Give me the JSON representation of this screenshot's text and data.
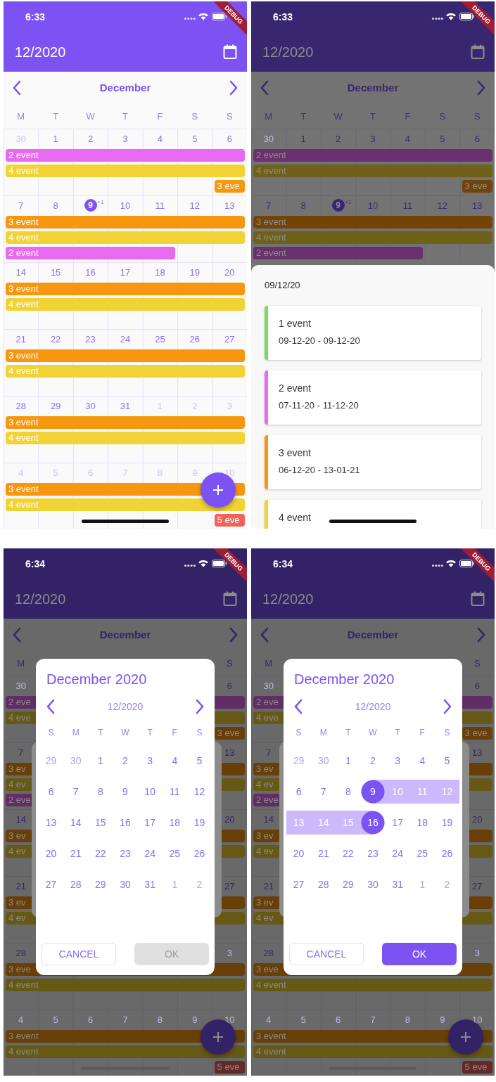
{
  "screens": [
    {
      "kind": "month",
      "status_time": "6:33",
      "banner": "DEBUG",
      "title": "12/2020",
      "month": "December",
      "weekdays": [
        {
          "label": "M"
        },
        {
          "label": "T"
        },
        {
          "label": "W"
        },
        {
          "label": "T"
        },
        {
          "label": "F"
        },
        {
          "label": "S"
        },
        {
          "label": "S"
        }
      ],
      "weeks": [
        {
          "days": [
            {
              "label": "30",
              "muted": true,
              "today": false
            },
            {
              "label": "1",
              "muted": false,
              "today": false
            },
            {
              "label": "2",
              "muted": false,
              "today": false
            },
            {
              "label": "3",
              "muted": false,
              "today": false
            },
            {
              "label": "4",
              "muted": false,
              "today": false
            },
            {
              "label": "5",
              "muted": false,
              "today": false
            },
            {
              "label": "6",
              "muted": false,
              "today": false
            }
          ],
          "events": [
            {
              "label": "2 event",
              "color": "#e86af0",
              "kind": "full"
            },
            {
              "label": "4 event",
              "color": "#f2d335",
              "kind": "full"
            },
            {
              "label": "3 eve",
              "color": "#f7970f",
              "kind": "sunday"
            }
          ]
        },
        {
          "days": [
            {
              "label": "7",
              "muted": false,
              "today": false
            },
            {
              "label": "8",
              "muted": false,
              "today": false
            },
            {
              "label": "9",
              "muted": false,
              "today": true,
              "extra": "+1"
            },
            {
              "label": "10",
              "muted": false,
              "today": false
            },
            {
              "label": "11",
              "muted": false,
              "today": false
            },
            {
              "label": "12",
              "muted": false,
              "today": false
            },
            {
              "label": "13",
              "muted": false,
              "today": false
            }
          ],
          "events": [
            {
              "label": "3 event",
              "color": "#f7970f",
              "kind": "full"
            },
            {
              "label": "4 event",
              "color": "#f2d335",
              "kind": "full"
            },
            {
              "label": "2 event",
              "color": "#e86af0",
              "kind": "weekdays"
            }
          ]
        },
        {
          "days": [
            {
              "label": "14",
              "muted": false,
              "today": false
            },
            {
              "label": "15",
              "muted": false,
              "today": false
            },
            {
              "label": "16",
              "muted": false,
              "today": false
            },
            {
              "label": "17",
              "muted": false,
              "today": false
            },
            {
              "label": "18",
              "muted": false,
              "today": false
            },
            {
              "label": "19",
              "muted": false,
              "today": false
            },
            {
              "label": "20",
              "muted": false,
              "today": false
            }
          ],
          "events": [
            {
              "label": "3 event",
              "color": "#f7970f",
              "kind": "full"
            },
            {
              "label": "4 event",
              "color": "#f2d335",
              "kind": "full"
            }
          ]
        },
        {
          "days": [
            {
              "label": "21",
              "muted": false,
              "today": false
            },
            {
              "label": "22",
              "muted": false,
              "today": false
            },
            {
              "label": "23",
              "muted": false,
              "today": false
            },
            {
              "label": "24",
              "muted": false,
              "today": false
            },
            {
              "label": "25",
              "muted": false,
              "today": false
            },
            {
              "label": "26",
              "muted": false,
              "today": false
            },
            {
              "label": "27",
              "muted": false,
              "today": false
            }
          ],
          "events": [
            {
              "label": "3 event",
              "color": "#f7970f",
              "kind": "full"
            },
            {
              "label": "4 event",
              "color": "#f2d335",
              "kind": "full"
            }
          ]
        },
        {
          "days": [
            {
              "label": "28",
              "muted": false,
              "today": false
            },
            {
              "label": "29",
              "muted": false,
              "today": false
            },
            {
              "label": "30",
              "muted": false,
              "today": false
            },
            {
              "label": "31",
              "muted": false,
              "today": false
            },
            {
              "label": "1",
              "muted": true,
              "today": false
            },
            {
              "label": "2",
              "muted": true,
              "today": false
            },
            {
              "label": "3",
              "muted": true,
              "today": false
            }
          ],
          "events": [
            {
              "label": "3 event",
              "color": "#f7970f",
              "kind": "full"
            },
            {
              "label": "4 event",
              "color": "#f2d335",
              "kind": "full"
            }
          ]
        },
        {
          "days": [
            {
              "label": "4",
              "muted": true,
              "today": false
            },
            {
              "label": "5",
              "muted": true,
              "today": false
            },
            {
              "label": "6",
              "muted": true,
              "today": false
            },
            {
              "label": "7",
              "muted": true,
              "today": false
            },
            {
              "label": "8",
              "muted": true,
              "today": false
            },
            {
              "label": "9",
              "muted": true,
              "today": false
            },
            {
              "label": "10",
              "muted": true,
              "today": false
            }
          ],
          "events": [
            {
              "label": "3 event",
              "color": "#f7970f",
              "kind": "full"
            },
            {
              "label": "4 event",
              "color": "#f2d335",
              "kind": "full"
            },
            {
              "label": "5 eve",
              "color": "#f1625a",
              "kind": "sunday"
            }
          ]
        }
      ]
    },
    {
      "kind": "day-sheet",
      "status_time": "6:33",
      "banner": "DEBUG",
      "title": "12/2020",
      "month": "December",
      "weekdays": [
        {
          "label": "M"
        },
        {
          "label": "T"
        },
        {
          "label": "W"
        },
        {
          "label": "T"
        },
        {
          "label": "F"
        },
        {
          "label": "S"
        },
        {
          "label": "S"
        }
      ],
      "weeks": [
        {
          "days": [
            {
              "label": "30",
              "muted": true,
              "today": false
            },
            {
              "label": "1",
              "muted": false,
              "today": false
            },
            {
              "label": "2",
              "muted": false,
              "today": false
            },
            {
              "label": "3",
              "muted": false,
              "today": false
            },
            {
              "label": "4",
              "muted": false,
              "today": false
            },
            {
              "label": "5",
              "muted": false,
              "today": false
            },
            {
              "label": "6",
              "muted": false,
              "today": false
            }
          ],
          "events": [
            {
              "label": "2 event",
              "color": "#6b316e",
              "kind": "full"
            },
            {
              "label": "4 event",
              "color": "#6f6118",
              "kind": "full"
            },
            {
              "label": "3 eve",
              "color": "#724507",
              "kind": "sunday"
            }
          ]
        },
        {
          "days": [
            {
              "label": "7",
              "muted": false,
              "today": false
            },
            {
              "label": "8",
              "muted": false,
              "today": false
            },
            {
              "label": "9",
              "muted": false,
              "today": true,
              "extra": "+1"
            },
            {
              "label": "10",
              "muted": false,
              "today": false
            },
            {
              "label": "11",
              "muted": false,
              "today": false
            },
            {
              "label": "12",
              "muted": false,
              "today": false
            },
            {
              "label": "13",
              "muted": false,
              "today": false
            }
          ],
          "events": [
            {
              "label": "3 event",
              "color": "#724507",
              "kind": "full"
            },
            {
              "label": "4 event",
              "color": "#6f6118",
              "kind": "full"
            },
            {
              "label": "2 event",
              "color": "#6b316e",
              "kind": "weekdays"
            }
          ]
        }
      ],
      "sheet": {
        "date": "09/12/20",
        "events": [
          {
            "title": "1 event",
            "range": "09-12-20 - 09-12-20",
            "color": "#7ed860"
          },
          {
            "title": "2 event",
            "range": "07-11-20 - 11-12-20",
            "color": "#e86af0"
          },
          {
            "title": "3 event",
            "range": "06-12-20 - 13-01-21",
            "color": "#f7970f"
          },
          {
            "title": "4 event",
            "color": "#f2d335"
          }
        ]
      }
    },
    {
      "kind": "range-dialog",
      "status_time": "6:34",
      "banner": "DEBUG",
      "title": "12/2020",
      "month": "December",
      "weekdays": [
        {
          "label": "M",
          "kind": "first"
        },
        {
          "label": "S",
          "kind": "last"
        }
      ],
      "weeks": [
        {
          "days": [
            {
              "label": "30",
              "kind": "first",
              "muted": true,
              "today": false
            },
            {
              "label": "6",
              "kind": "last",
              "muted": false,
              "today": false
            }
          ],
          "events": [
            {
              "label": "2 eve",
              "color": "#612d65",
              "kind": "full"
            },
            {
              "label": "4 eve",
              "color": "#665916",
              "kind": "full"
            },
            {
              "label": "3 eve",
              "color": "#683f06",
              "kind": "sunday"
            }
          ]
        },
        {
          "days": [
            {
              "label": "7",
              "kind": "first",
              "muted": false,
              "today": false
            },
            {
              "label": "13",
              "kind": "last",
              "muted": false,
              "today": false
            }
          ],
          "events": [
            {
              "label": "3 ev",
              "color": "#683f06",
              "kind": "full"
            },
            {
              "label": "4 ev",
              "color": "#665916",
              "kind": "full"
            },
            {
              "label": "2 eve",
              "color": "#612d65",
              "kind": "weekdays"
            }
          ]
        },
        {
          "days": [
            {
              "label": "14",
              "kind": "first",
              "muted": false,
              "today": false
            },
            {
              "label": "20",
              "kind": "last",
              "muted": false,
              "today": false
            }
          ],
          "events": [
            {
              "label": "3 ev",
              "color": "#683f06",
              "kind": "full"
            },
            {
              "label": "4 ev",
              "color": "#665916",
              "kind": "full"
            }
          ]
        },
        {
          "days": [
            {
              "label": "21",
              "kind": "first",
              "muted": false,
              "today": false
            },
            {
              "label": "27",
              "kind": "last",
              "muted": false,
              "today": false
            }
          ],
          "events": [
            {
              "label": "3 ev",
              "color": "#683f06",
              "kind": "full"
            },
            {
              "label": "4 ev",
              "color": "#665916",
              "kind": "full"
            }
          ]
        },
        {
          "days": [
            {
              "label": "28",
              "kind": "first",
              "muted": false,
              "today": false
            },
            {
              "label": "3",
              "kind": "last",
              "muted": true,
              "today": false
            }
          ],
          "events": [
            {
              "label": "3 eve",
              "color": "#683f06",
              "kind": "full"
            },
            {
              "label": "4 event",
              "color": "#665916",
              "kind": "full"
            }
          ]
        },
        {
          "days": [
            {
              "label": "4",
              "muted": true,
              "today": false
            },
            {
              "label": "5",
              "muted": true,
              "today": false
            },
            {
              "label": "6",
              "muted": true,
              "today": false
            },
            {
              "label": "7",
              "muted": true,
              "today": false
            },
            {
              "label": "8",
              "muted": true,
              "today": false
            },
            {
              "label": "9",
              "muted": true,
              "today": false
            },
            {
              "label": "10",
              "muted": true,
              "today": false
            }
          ],
          "events": [
            {
              "label": "3 event",
              "color": "#683f06",
              "kind": "full"
            },
            {
              "label": "4 event",
              "color": "#665916",
              "kind": "full"
            },
            {
              "label": "5 eve",
              "color": "#652926",
              "kind": "sunday"
            }
          ]
        }
      ],
      "dialog": {
        "title": "December 2020",
        "month": "12/2020",
        "weekdays": [
          "S",
          "M",
          "T",
          "W",
          "T",
          "F",
          "S"
        ],
        "days": [
          {
            "label": "29",
            "muted": true,
            "selected": false,
            "in_range": false
          },
          {
            "label": "30",
            "muted": true,
            "selected": false,
            "in_range": false
          },
          {
            "label": "1",
            "muted": false,
            "selected": false,
            "in_range": false
          },
          {
            "label": "2",
            "muted": false,
            "selected": false,
            "in_range": false
          },
          {
            "label": "3",
            "muted": false,
            "selected": false,
            "in_range": false
          },
          {
            "label": "4",
            "muted": false,
            "selected": false,
            "in_range": false
          },
          {
            "label": "5",
            "muted": false,
            "selected": false,
            "in_range": false
          },
          {
            "label": "6",
            "muted": false,
            "selected": false,
            "in_range": false
          },
          {
            "label": "7",
            "muted": false,
            "selected": false,
            "in_range": false
          },
          {
            "label": "8",
            "muted": false,
            "selected": false,
            "in_range": false
          },
          {
            "label": "9",
            "muted": false,
            "selected": false,
            "in_range": false
          },
          {
            "label": "10",
            "muted": false,
            "selected": false,
            "in_range": false
          },
          {
            "label": "11",
            "muted": false,
            "selected": false,
            "in_range": false
          },
          {
            "label": "12",
            "muted": false,
            "selected": false,
            "in_range": false
          },
          {
            "label": "13",
            "muted": false,
            "selected": false,
            "in_range": false
          },
          {
            "label": "14",
            "muted": false,
            "selected": false,
            "in_range": false
          },
          {
            "label": "15",
            "muted": false,
            "selected": false,
            "in_range": false
          },
          {
            "label": "16",
            "muted": false,
            "selected": false,
            "in_range": false
          },
          {
            "label": "17",
            "muted": false,
            "selected": false,
            "in_range": false
          },
          {
            "label": "18",
            "muted": false,
            "selected": false,
            "in_range": false
          },
          {
            "label": "19",
            "muted": false,
            "selected": false,
            "in_range": false
          },
          {
            "label": "20",
            "muted": false,
            "selected": false,
            "in_range": false
          },
          {
            "label": "21",
            "muted": false,
            "selected": false,
            "in_range": false
          },
          {
            "label": "22",
            "muted": false,
            "selected": false,
            "in_range": false
          },
          {
            "label": "23",
            "muted": false,
            "selected": false,
            "in_range": false
          },
          {
            "label": "24",
            "muted": false,
            "selected": false,
            "in_range": false
          },
          {
            "label": "25",
            "muted": false,
            "selected": false,
            "in_range": false
          },
          {
            "label": "26",
            "muted": false,
            "selected": false,
            "in_range": false
          },
          {
            "label": "27",
            "muted": false,
            "selected": false,
            "in_range": false
          },
          {
            "label": "28",
            "muted": false,
            "selected": false,
            "in_range": false
          },
          {
            "label": "29",
            "muted": false,
            "selected": false,
            "in_range": false
          },
          {
            "label": "30",
            "muted": false,
            "selected": false,
            "in_range": false
          },
          {
            "label": "31",
            "muted": false,
            "selected": false,
            "in_range": false
          },
          {
            "label": "1",
            "muted": true,
            "selected": false,
            "in_range": false
          },
          {
            "label": "2",
            "muted": true,
            "selected": false,
            "in_range": false
          }
        ],
        "buttons": [
          {
            "label": "CANCEL",
            "kind": "outlined",
            "disabled": false
          },
          {
            "label": "OK",
            "kind": "filled",
            "disabled": true
          }
        ]
      }
    },
    {
      "kind": "range-dialog",
      "status_time": "6:34",
      "banner": "DEBUG",
      "title": "12/2020",
      "month": "December",
      "weekdays": [
        {
          "label": "M",
          "kind": "first"
        },
        {
          "label": "S",
          "kind": "last"
        }
      ],
      "weeks": [
        {
          "days": [
            {
              "label": "30",
              "kind": "first",
              "muted": true,
              "today": false
            },
            {
              "label": "6",
              "kind": "last",
              "muted": false,
              "today": false
            }
          ],
          "events": [
            {
              "label": "2 eve",
              "color": "#612d65",
              "kind": "full"
            },
            {
              "label": "4 eve",
              "color": "#665916",
              "kind": "full"
            },
            {
              "label": "3 eve",
              "color": "#683f06",
              "kind": "sunday"
            }
          ]
        },
        {
          "days": [
            {
              "label": "7",
              "kind": "first",
              "muted": false,
              "today": false
            },
            {
              "label": "13",
              "kind": "last",
              "muted": false,
              "today": false
            }
          ],
          "events": [
            {
              "label": "3 ev",
              "color": "#683f06",
              "kind": "full"
            },
            {
              "label": "4 ev",
              "color": "#665916",
              "kind": "full"
            },
            {
              "label": "2 eve",
              "color": "#612d65",
              "kind": "weekdays"
            }
          ]
        },
        {
          "days": [
            {
              "label": "14",
              "kind": "first",
              "muted": false,
              "today": false
            },
            {
              "label": "20",
              "kind": "last",
              "muted": false,
              "today": false
            }
          ],
          "events": [
            {
              "label": "3 ev",
              "color": "#683f06",
              "kind": "full"
            },
            {
              "label": "4 ev",
              "color": "#665916",
              "kind": "full"
            }
          ]
        },
        {
          "days": [
            {
              "label": "21",
              "kind": "first",
              "muted": false,
              "today": false
            },
            {
              "label": "27",
              "kind": "last",
              "muted": false,
              "today": false
            }
          ],
          "events": [
            {
              "label": "3 ev",
              "color": "#683f06",
              "kind": "full"
            },
            {
              "label": "4 ev",
              "color": "#665916",
              "kind": "full"
            }
          ]
        },
        {
          "days": [
            {
              "label": "28",
              "kind": "first",
              "muted": false,
              "today": false
            },
            {
              "label": "3",
              "kind": "last",
              "muted": true,
              "today": false
            }
          ],
          "events": [
            {
              "label": "3 eve",
              "color": "#683f06",
              "kind": "full"
            },
            {
              "label": "4 event",
              "color": "#665916",
              "kind": "full"
            }
          ]
        },
        {
          "days": [
            {
              "label": "4",
              "muted": true,
              "today": false
            },
            {
              "label": "5",
              "muted": true,
              "today": false
            },
            {
              "label": "6",
              "muted": true,
              "today": false
            },
            {
              "label": "7",
              "muted": true,
              "today": false
            },
            {
              "label": "8",
              "muted": true,
              "today": false
            },
            {
              "label": "9",
              "muted": true,
              "today": false
            },
            {
              "label": "10",
              "muted": true,
              "today": false
            }
          ],
          "events": [
            {
              "label": "3 event",
              "color": "#683f06",
              "kind": "full"
            },
            {
              "label": "4 event",
              "color": "#665916",
              "kind": "full"
            },
            {
              "label": "5 eve",
              "color": "#652926",
              "kind": "sunday"
            }
          ]
        }
      ],
      "dialog": {
        "title": "December 2020",
        "month": "12/2020",
        "weekdays": [
          "S",
          "M",
          "T",
          "W",
          "T",
          "F",
          "S"
        ],
        "days": [
          {
            "label": "29",
            "muted": true,
            "selected": false,
            "in_range": false
          },
          {
            "label": "30",
            "muted": true,
            "selected": false,
            "in_range": false
          },
          {
            "label": "1",
            "muted": false,
            "selected": false,
            "in_range": false
          },
          {
            "label": "2",
            "muted": false,
            "selected": false,
            "in_range": false
          },
          {
            "label": "3",
            "muted": false,
            "selected": false,
            "in_range": false
          },
          {
            "label": "4",
            "muted": false,
            "selected": false,
            "in_range": false
          },
          {
            "label": "5",
            "muted": false,
            "selected": false,
            "in_range": false
          },
          {
            "label": "6",
            "muted": false,
            "selected": false,
            "in_range": false
          },
          {
            "label": "7",
            "muted": false,
            "selected": false,
            "in_range": false
          },
          {
            "label": "8",
            "muted": false,
            "selected": false,
            "in_range": false
          },
          {
            "label": "9",
            "muted": false,
            "selected": true,
            "in_range": false
          },
          {
            "label": "10",
            "muted": false,
            "selected": false,
            "in_range": true
          },
          {
            "label": "11",
            "muted": false,
            "selected": false,
            "in_range": true
          },
          {
            "label": "12",
            "muted": false,
            "selected": false,
            "in_range": true
          },
          {
            "label": "13",
            "muted": false,
            "selected": false,
            "in_range": true
          },
          {
            "label": "14",
            "muted": false,
            "selected": false,
            "in_range": true
          },
          {
            "label": "15",
            "muted": false,
            "selected": false,
            "in_range": true
          },
          {
            "label": "16",
            "muted": false,
            "selected": true,
            "in_range": false
          },
          {
            "label": "17",
            "muted": false,
            "selected": false,
            "in_range": false
          },
          {
            "label": "18",
            "muted": false,
            "selected": false,
            "in_range": false
          },
          {
            "label": "19",
            "muted": false,
            "selected": false,
            "in_range": false
          },
          {
            "label": "20",
            "muted": false,
            "selected": false,
            "in_range": false
          },
          {
            "label": "21",
            "muted": false,
            "selected": false,
            "in_range": false
          },
          {
            "label": "22",
            "muted": false,
            "selected": false,
            "in_range": false
          },
          {
            "label": "23",
            "muted": false,
            "selected": false,
            "in_range": false
          },
          {
            "label": "24",
            "muted": false,
            "selected": false,
            "in_range": false
          },
          {
            "label": "25",
            "muted": false,
            "selected": false,
            "in_range": false
          },
          {
            "label": "26",
            "muted": false,
            "selected": false,
            "in_range": false
          },
          {
            "label": "27",
            "muted": false,
            "selected": false,
            "in_range": false
          },
          {
            "label": "28",
            "muted": false,
            "selected": false,
            "in_range": false
          },
          {
            "label": "29",
            "muted": false,
            "selected": false,
            "in_range": false
          },
          {
            "label": "30",
            "muted": false,
            "selected": false,
            "in_range": false
          },
          {
            "label": "31",
            "muted": false,
            "selected": false,
            "in_range": false
          },
          {
            "label": "1",
            "muted": true,
            "selected": false,
            "in_range": false
          },
          {
            "label": "2",
            "muted": true,
            "selected": false,
            "in_range": false
          }
        ],
        "buttons": [
          {
            "label": "CANCEL",
            "kind": "outlined",
            "disabled": false
          },
          {
            "label": "OK",
            "kind": "filled",
            "disabled": false
          }
        ]
      }
    }
  ]
}
